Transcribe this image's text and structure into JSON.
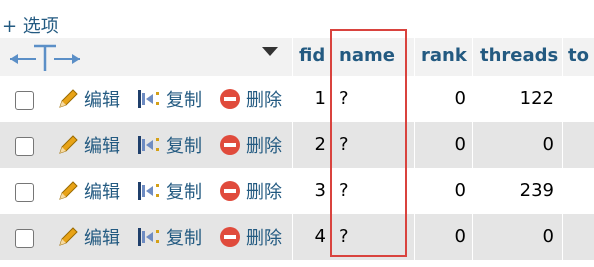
{
  "options_label": "+ 选项",
  "columns": [
    "fid",
    "name",
    "rank",
    "threads",
    "to"
  ],
  "actions": {
    "edit": "编辑",
    "copy": "复制",
    "delete": "删除"
  },
  "rows": [
    {
      "fid": "1",
      "name": "?",
      "rank": "0",
      "threads": "122"
    },
    {
      "fid": "2",
      "name": "?",
      "rank": "0",
      "threads": "0"
    },
    {
      "fid": "3",
      "name": "?",
      "rank": "0",
      "threads": "239"
    },
    {
      "fid": "4",
      "name": "?",
      "rank": "0",
      "threads": "0"
    }
  ],
  "colors": {
    "link": "#235a81",
    "header_bg": "#f2f2f2",
    "row_even_bg": "#e5e5e5",
    "highlight_border": "#d9433e",
    "delete_icon": "#e04b3c",
    "pencil_icon": "#e8a317"
  },
  "icons": [
    "column-resize-arrows-icon",
    "sort-caret-icon",
    "pencil-icon",
    "copy-icon",
    "delete-icon"
  ]
}
